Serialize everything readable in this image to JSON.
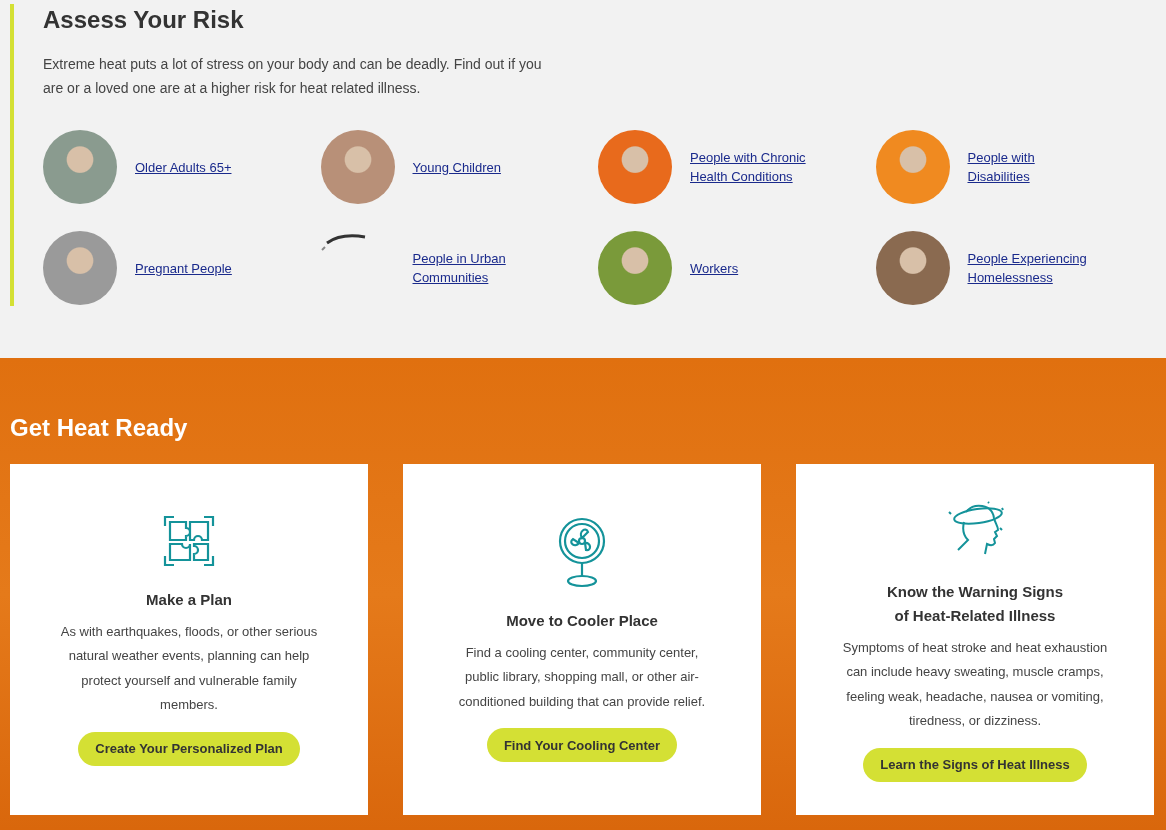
{
  "risk": {
    "title": "Assess Your Risk",
    "intro": "Extreme heat puts a lot of stress on your body and can be deadly. Find out if you are or a loved one are at a higher risk for heat related illness.",
    "groups": [
      {
        "label": "Older Adults 65+",
        "kind": "photo"
      },
      {
        "label": "Young Children",
        "kind": "photo"
      },
      {
        "label": "People with Chronic Health Conditions",
        "kind": "photo"
      },
      {
        "label": "People with Disabilities",
        "kind": "photo"
      },
      {
        "label": "Pregnant People",
        "kind": "photo"
      },
      {
        "label": "People in Urban Communities",
        "kind": "broken"
      },
      {
        "label": "Workers",
        "kind": "photo"
      },
      {
        "label": "People Experiencing Homelessness",
        "kind": "photo"
      }
    ]
  },
  "ready": {
    "title": "Get Heat Ready",
    "cards": [
      {
        "kind": "puzzle",
        "title": "Make a Plan",
        "text": "As with earthquakes, floods, or other serious natural weather events, planning can help protect yourself and vulnerable family members.",
        "button": "Create Your Personalized Plan"
      },
      {
        "kind": "fan",
        "title": "Move to Cooler Place",
        "text": "Find a cooling center, community center, public library, shopping mall, or other air-conditioned building that can provide relief.",
        "button": "Find Your Cooling Center"
      },
      {
        "kind": "head",
        "title": "Know the Warning Signs\nof Heat-Related Illness",
        "text": "Symptoms of heat stroke and heat exhaustion can include heavy sweating, muscle cramps, feeling weak, headache, nausea or vomiting, tiredness, or dizziness.",
        "button": "Learn the Signs of Heat Illness"
      }
    ]
  }
}
